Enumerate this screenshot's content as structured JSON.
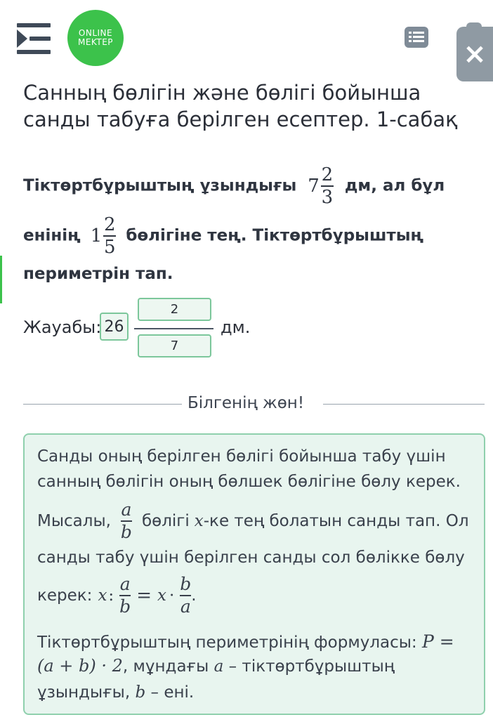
{
  "header": {
    "menu_icon": "menu-collapse-icon",
    "logo_line1": "ONLINE",
    "logo_line2": "MEKTEP",
    "list_icon": "list-icon",
    "close_label": "×"
  },
  "lesson_title": "Санның бөлігін және бөлігі бойынша санды табуға берілген есептер. 1-сабақ",
  "question": {
    "part1": "Тіктөртбұрыштың ұзындығы",
    "length_whole": "7",
    "length_num": "2",
    "length_den": "3",
    "part2": "дм, ал бұл",
    "part3": "енінің",
    "ratio_whole": "1",
    "ratio_num": "2",
    "ratio_den": "5",
    "part4": "бөлігіне тең. Тіктөртбұрыштың",
    "part5": "периметрін тап."
  },
  "answer": {
    "label": "Жауабы:",
    "whole": "26",
    "numerator": "2",
    "denominator": "7",
    "unit": "дм."
  },
  "divider_text": "Білгенің жөн!",
  "info": {
    "line1": "Санды оның берілген бөлігі бойынша табу үшін",
    "line2": "санның бөлігін оның бөлшек бөлігіне бөлу керек.",
    "ex_prefix": "Мысалы,",
    "ex_num": "a",
    "ex_den": "b",
    "ex_mid": "бөлігі",
    "ex_var": "x",
    "ex_suffix": "-ке тең болатын санды тап. Ол",
    "line4": "санды табу үшін берілген санды сол бөлікке бөлу",
    "f_prefix": "керек:",
    "f_x1": "x",
    "f_colon": ":",
    "f_n1": "a",
    "f_d1": "b",
    "f_eq": "=",
    "f_x2": "x",
    "f_dot": "·",
    "f_n2": "b",
    "f_d2": "a",
    "f_end": ".",
    "p_line1_text": "Тіктөртбұрыштың периметрінің формуласы:",
    "p_line1_math": "P =",
    "p_line2_math": "(a + b) · 2",
    "p_line2_text": ", мұндағы",
    "p_var_a": "a",
    "p_line2_end": "– тіктөртбұрыштың",
    "p_line3_text": "ұзындығы,",
    "p_var_b": "b",
    "p_line3_end": "– ені."
  }
}
